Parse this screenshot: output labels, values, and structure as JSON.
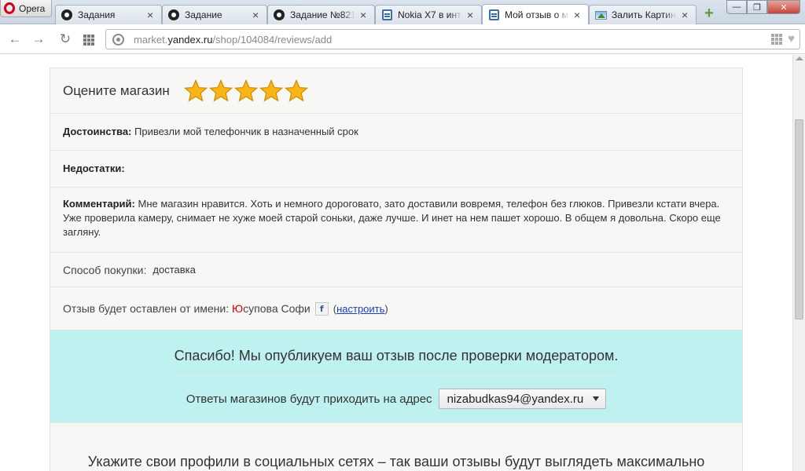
{
  "browser": {
    "opera_label": "Opera",
    "tabs": [
      {
        "label": "Задания",
        "icon": "yandex-icon",
        "active": false
      },
      {
        "label": "Задание",
        "icon": "yandex-icon",
        "active": false
      },
      {
        "label": "Задание №821",
        "icon": "yandex-icon",
        "active": false
      },
      {
        "label": "Nokia X7 в инте",
        "icon": "document-icon",
        "active": false
      },
      {
        "label": "Мой отзыв о м",
        "icon": "document-icon",
        "active": true
      },
      {
        "label": "Залить Картин",
        "icon": "image-icon",
        "active": false
      }
    ],
    "tab_close_glyph": "×",
    "new_tab_glyph": "+",
    "window_controls": {
      "minimize": "—",
      "maximize": "❐",
      "close": "✕"
    },
    "nav": {
      "back": "←",
      "forward": "→",
      "reload": "↻"
    },
    "address": {
      "prefix": "market.",
      "domain": "yandex.ru",
      "path": "/shop/104084/reviews/add"
    }
  },
  "review": {
    "rating_title": "Оцените магазин",
    "rating_value": 5,
    "rating_max": 5,
    "advantages_label": "Достоинства:",
    "advantages_text": "Привезли мой телефончик в назначенный срок",
    "disadvantages_label": "Недостатки:",
    "comment_label": "Комментарий:",
    "comment_text": "Мне магазин нравится. Хоть и немного дороговато, зато доставили вовремя, телефон без глюков. Привезли кстати вчера. Уже проверила камеру, снимает не хуже моей старой соньки, даже лучше. И инет на нем пашет хорошо. В общем я довольна. Скоро еще загляну.",
    "purchase_label": "Способ покупки:",
    "purchase_value": "доставка",
    "author_label": "Отзыв будет оставлен от имени:",
    "author_first_letter": "Ю",
    "author_rest": "супова Софи",
    "author_network_icon": "f",
    "settings_open": "(",
    "settings_link": "настроить",
    "settings_close": ")"
  },
  "thanks": {
    "title": "Спасибо! Мы опубликуем ваш отзыв после проверки модератором.",
    "email_label": "Ответы магазинов будут приходить на адрес",
    "email_value": "nizabudkas94@yandex.ru"
  },
  "social": {
    "text": "Укажите свои профили в социальных сетях – так ваши отзывы будут выглядеть максимально"
  },
  "colors": {
    "accent_red": "#d1000c",
    "link": "#1a3dc1",
    "thanks_bg": "#bff1f1",
    "star": "#f9b515"
  }
}
